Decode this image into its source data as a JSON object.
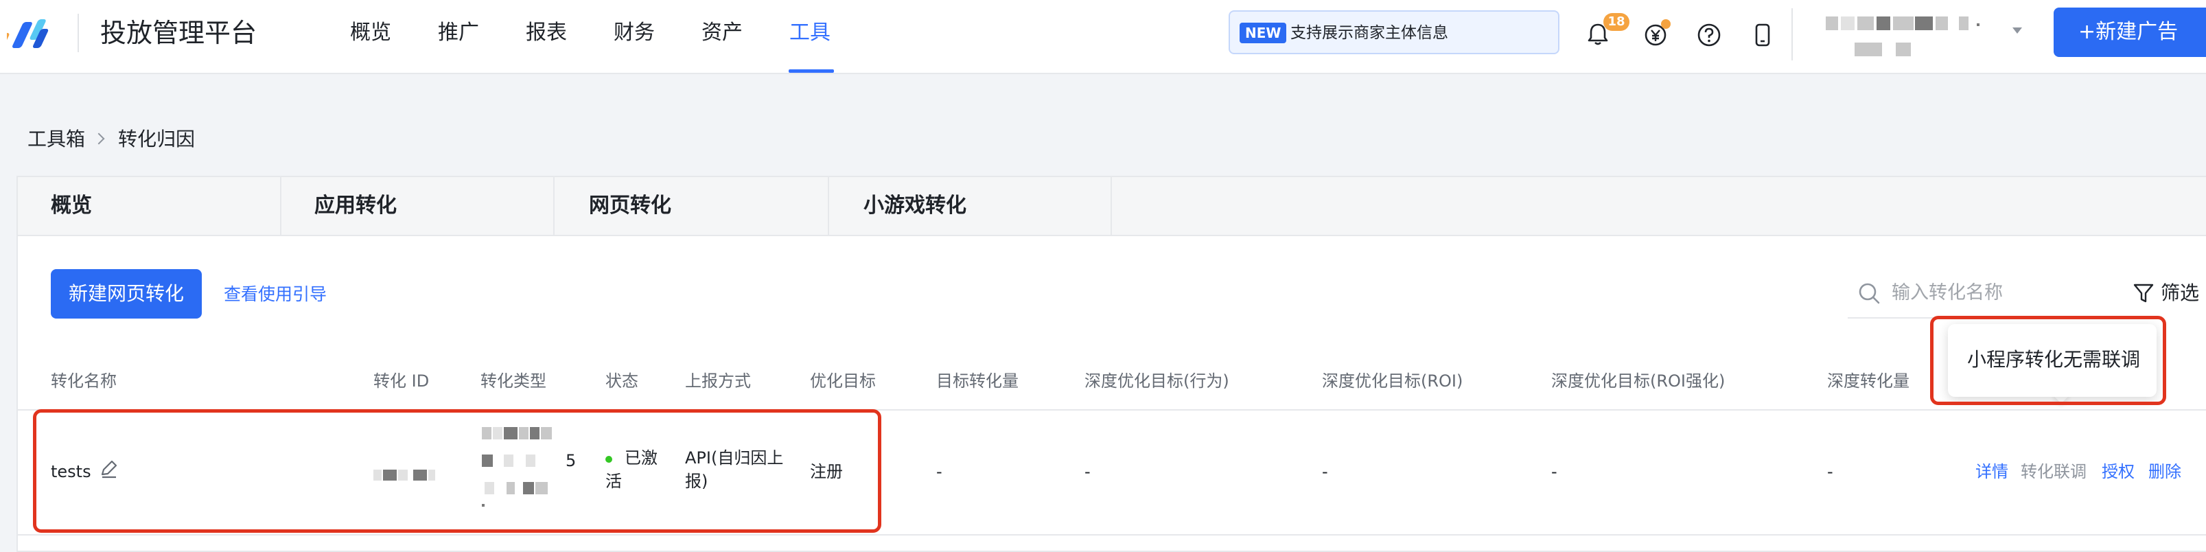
{
  "header": {
    "brand": "投放管理平台",
    "nav": [
      "概览",
      "推广",
      "报表",
      "财务",
      "资产",
      "工具"
    ],
    "active_nav": "工具",
    "notice": {
      "badge": "NEW",
      "text": "支持展示商家主体信息"
    },
    "bell_count": "18",
    "new_ad_button": "+新建广告",
    "icons": [
      "bell-icon",
      "yen-icon",
      "help-icon",
      "phone-icon"
    ]
  },
  "breadcrumb": [
    "工具箱",
    "转化归因"
  ],
  "tabs": [
    "概览",
    "应用转化",
    "网页转化",
    "小游戏转化"
  ],
  "toolbar": {
    "create_button": "新建网页转化",
    "guide_link": "查看使用引导",
    "search_placeholder": "输入转化名称",
    "filter_label": "筛选"
  },
  "table": {
    "columns": [
      "转化名称",
      "转化 ID",
      "转化类型",
      "状态",
      "上报方式",
      "优化目标",
      "目标转化量",
      "深度优化目标(行为)",
      "深度优化目标(ROI)",
      "深度优化目标(ROI强化)",
      "深度转化量"
    ],
    "rows": [
      {
        "name": "tests",
        "type_digit": "5",
        "status": "已激活",
        "report_method": "API(自归因上报)",
        "optimize_goal": "注册",
        "target_volume": "-",
        "deep_behavior": "-",
        "deep_roi": "-",
        "deep_roi_plus": "-",
        "deep_volume": "-",
        "actions": [
          "详情",
          "转化联调",
          "授权",
          "删除"
        ]
      }
    ]
  },
  "tooltip": "小程序转化无需联调",
  "colors": {
    "primary": "#2b6bf3",
    "link": "#3370ff",
    "annotation": "#e1341e",
    "badge": "#f5a340",
    "status_active": "#34c724"
  }
}
